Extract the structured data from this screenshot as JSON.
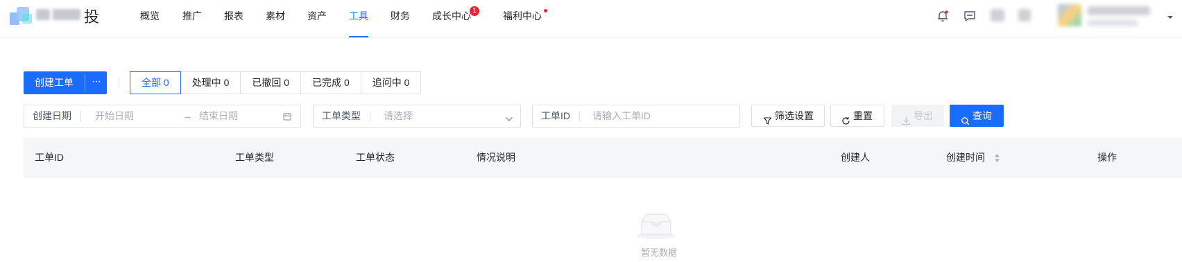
{
  "brand": {
    "suffix": "投"
  },
  "nav": {
    "items": [
      {
        "label": "概览"
      },
      {
        "label": "推广"
      },
      {
        "label": "报表"
      },
      {
        "label": "素材"
      },
      {
        "label": "资产"
      },
      {
        "label": "工具",
        "active": true
      },
      {
        "label": "财务"
      },
      {
        "label": "成长中心",
        "badge": "1"
      },
      {
        "label": "福利中心",
        "dot": true
      }
    ]
  },
  "header_icons": [
    "bell-icon",
    "message-icon"
  ],
  "toolbar": {
    "create_label": "创建工单",
    "more_label": "···",
    "tabs": [
      {
        "label": "全部 0",
        "active": true
      },
      {
        "label": "处理中 0"
      },
      {
        "label": "已撤回 0"
      },
      {
        "label": "已完成 0"
      },
      {
        "label": "追问中 0"
      }
    ]
  },
  "filters": {
    "date_label": "创建日期",
    "date_start_placeholder": "开始日期",
    "date_arrow": "→",
    "date_end_placeholder": "结束日期",
    "type_label": "工单类型",
    "type_placeholder": "请选择",
    "id_label": "工单ID",
    "id_placeholder": "请输入工单ID",
    "filter_settings": "筛选设置",
    "reset": "重置",
    "export": "导出",
    "query": "查询"
  },
  "table": {
    "columns": [
      "工单ID",
      "工单类型",
      "工单状态",
      "情况说明",
      "创建人",
      "创建时间",
      "操作"
    ],
    "sortable_column": "创建时间",
    "rows": [],
    "empty_text": "暂无数据"
  },
  "colors": {
    "primary": "#1a6cff",
    "badge": "#f5222d",
    "header_bg": "#f5f6f8",
    "placeholder": "#a9aeb8"
  }
}
